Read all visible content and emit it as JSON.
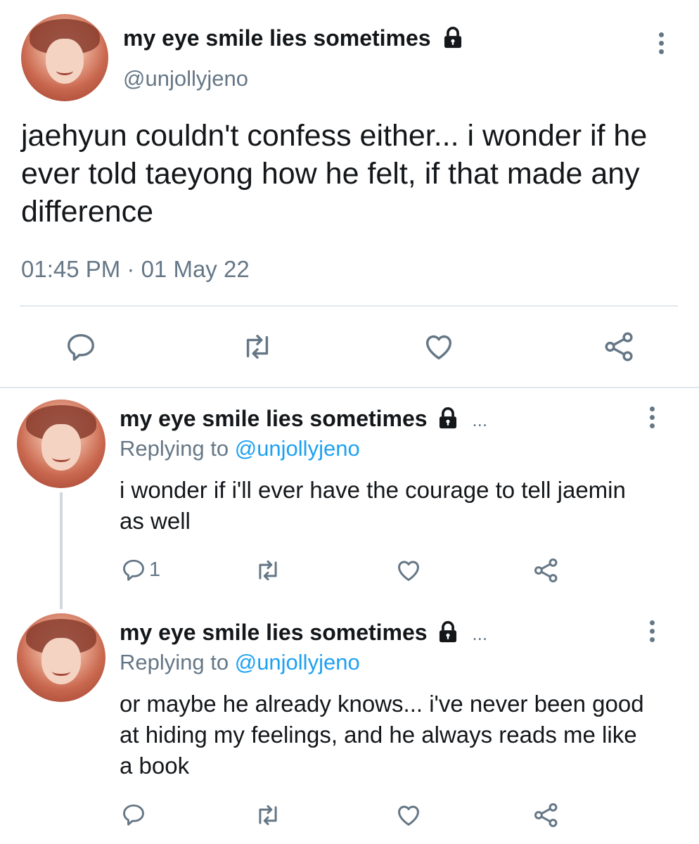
{
  "main_tweet": {
    "display_name": "my eye smile lies sometimes",
    "handle": "@unjollyjeno",
    "text": "jaehyun couldn't confess either... i wonder if he ever told taeyong how he felt, if that made any difference",
    "timestamp": "01:45 PM · 01 May 22",
    "icons": [
      "lock-icon",
      "more-icon",
      "reply-icon",
      "retweet-icon",
      "like-icon",
      "share-icon"
    ]
  },
  "replies": [
    {
      "display_name": "my eye smile lies sometimes",
      "ellipsis": "...",
      "replying_prefix": "Replying to",
      "replying_handle": "@unjollyjeno",
      "text": "i wonder if i'll ever have the courage to tell jaemin as well",
      "reply_count": "1"
    },
    {
      "display_name": "my eye smile lies sometimes",
      "ellipsis": "...",
      "replying_prefix": "Replying to",
      "replying_handle": "@unjollyjeno",
      "text": "or maybe he already knows... i've never been good at hiding my feelings, and he always reads me like a book",
      "reply_count": ""
    }
  ],
  "colors": {
    "text": "#14171a",
    "secondary": "#657786",
    "link": "#1da1f2",
    "divider": "#e1e8ed"
  }
}
